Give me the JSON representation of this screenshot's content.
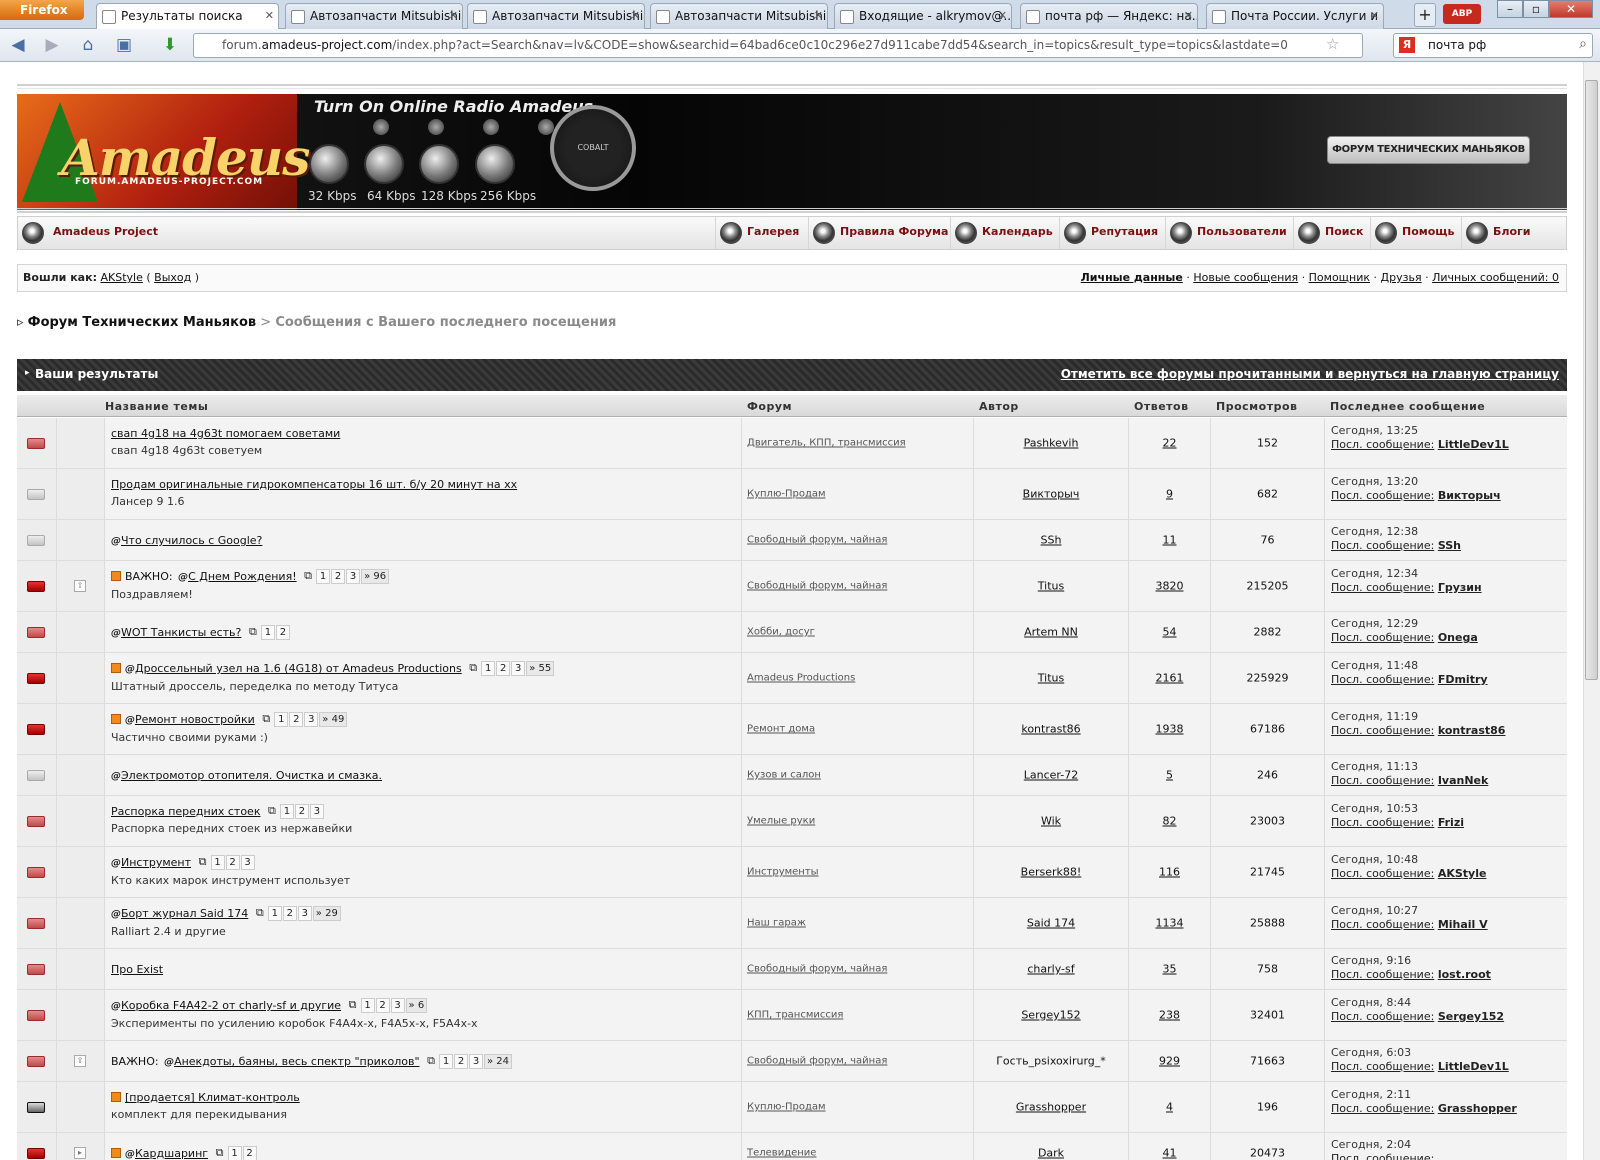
{
  "browser": {
    "menu_label": "Firefox",
    "tabs": [
      {
        "label": "Результаты поиска",
        "active": true
      },
      {
        "label": "Автозапчасти Mitsubishi ..."
      },
      {
        "label": "Автозапчасти Mitsubishi ..."
      },
      {
        "label": "Автозапчасти Mitsubishi ..."
      },
      {
        "label": "Входящие - alkrymov@..."
      },
      {
        "label": "почта рф — Яндекс: на..."
      },
      {
        "label": "Почта России. Услуги и ..."
      }
    ],
    "new_tab_label": "+",
    "addon_label": "ABP",
    "url_prefix": "forum.",
    "url_domain": "amadeus-project.com",
    "url_rest": "/index.php?act=Search&nav=lv&CODE=show&searchid=64bad6ce0c10c296e27d911cabe7dd54&search_in=topics&result_type=topics&lastdate=0",
    "search_engine_glyph": "Я",
    "search_value": "почта рф"
  },
  "banner": {
    "logo": "Amadeus",
    "logo_url": "FORUM.AMADEUS-PROJECT.COM",
    "radio_title": "Turn On Online Radio Amadeus",
    "kbps": [
      "32 Kbps",
      "64 Kbps",
      "128 Kbps",
      "256 Kbps"
    ],
    "gauge_label": "COBALT",
    "badge": "ФОРУМ ТЕХНИЧЕСКИХ МАНЬЯКОВ"
  },
  "nav": {
    "brand": "Amadeus Project",
    "items": [
      "Галерея",
      "Правила Форума",
      "Календарь",
      "Репутация",
      "Пользователи",
      "Поиск",
      "Помощь",
      "Блоги"
    ]
  },
  "user": {
    "logged_as": "Вошли как:",
    "name": "AKStyle",
    "logout": "Выход",
    "links": [
      "Личные данные",
      "Новые сообщения",
      "Помощник",
      "Друзья",
      "Личных сообщений: 0"
    ]
  },
  "breadcrumb": {
    "marker": "▹",
    "forum": "Форум Технических Маньяков",
    "separator": ">",
    "current": "Сообщения с Вашего последнего посещения"
  },
  "results": {
    "title": "Ваши результаты",
    "mark_read": "Отметить все форумы прочитанными и вернуться на главную страницу",
    "columns": [
      "Название темы",
      "Форум",
      "Автор",
      "Ответов",
      "Просмотров",
      "Последнее сообщение"
    ],
    "last_prefix": "Посл. сообщение:",
    "rows": [
      {
        "folder": "red",
        "hot": false,
        "important": false,
        "clip": false,
        "title": "свап 4g18 на 4g63t помогаем советами",
        "pages": [],
        "desc": "свап 4g18 4g63t советуем",
        "forum": "Двигатель, КПП, трансмиссия",
        "author": "Pashkevih",
        "replies": "22",
        "views": "152",
        "last_time": "Сегодня, 13:25",
        "last_user": "LittleDev1L"
      },
      {
        "folder": "grey",
        "hot": false,
        "important": false,
        "clip": false,
        "title": "Продам оригинальные гидрокомпенсаторы 16 шт. б/у 20 минут на хх",
        "pages": [],
        "desc": "Лансер 9 1.6",
        "forum": "Куплю-Продам",
        "author": "Викторыч",
        "replies": "9",
        "views": "682",
        "last_time": "Сегодня, 13:20",
        "last_user": "Викторыч"
      },
      {
        "folder": "grey",
        "hot": false,
        "important": false,
        "clip": true,
        "title": "Что случилось с Google?",
        "pages": [],
        "desc": "",
        "forum": "Свободный форум, чайная",
        "author": "SSh",
        "replies": "11",
        "views": "76",
        "last_time": "Сегодня, 12:38",
        "last_user": "SSh"
      },
      {
        "folder": "hot",
        "pin": "⇧",
        "hot": true,
        "important": true,
        "clip": true,
        "title": "С Днем Рождения!",
        "pages": [
          "1",
          "2",
          "3",
          "» 96"
        ],
        "desc": "Поздравляем!",
        "forum": "Свободный форум, чайная",
        "author": "Titus",
        "replies": "3820",
        "views": "215205",
        "last_time": "Сегодня, 12:34",
        "last_user": "Грузин"
      },
      {
        "folder": "red",
        "hot": false,
        "important": false,
        "clip": true,
        "title": "WOT Танкисты есть?",
        "pages": [
          "1",
          "2"
        ],
        "desc": "",
        "forum": "Хобби, досуг",
        "author": "Artem NN",
        "replies": "54",
        "views": "2882",
        "last_time": "Сегодня, 12:29",
        "last_user": "Onega"
      },
      {
        "folder": "hot",
        "hot": true,
        "important": false,
        "clip": true,
        "title": "Дроссельный узел на 1.6 (4G18) от Amadeus Productions",
        "pages": [
          "1",
          "2",
          "3",
          "» 55"
        ],
        "desc": "Штатный дроссель, переделка по методу Титуса",
        "forum": "Amadeus Productions",
        "author": "Titus",
        "replies": "2161",
        "views": "225929",
        "last_time": "Сегодня, 11:48",
        "last_user": "FDmitry"
      },
      {
        "folder": "hot",
        "hot": true,
        "important": false,
        "clip": true,
        "title": "Ремонт новостройки",
        "pages": [
          "1",
          "2",
          "3",
          "» 49"
        ],
        "desc": "Частично своими руками :)",
        "forum": "Ремонт дома",
        "author": "kontrast86",
        "replies": "1938",
        "views": "67186",
        "last_time": "Сегодня, 11:19",
        "last_user": "kontrast86"
      },
      {
        "folder": "grey",
        "hot": false,
        "important": false,
        "clip": true,
        "title": "Электромотор отопителя. Очистка и смазка.",
        "pages": [],
        "desc": "",
        "forum": "Кузов и салон",
        "author": "Lancer-72",
        "replies": "5",
        "views": "246",
        "last_time": "Сегодня, 11:13",
        "last_user": "IvanNek"
      },
      {
        "folder": "red",
        "hot": false,
        "important": false,
        "clip": false,
        "title": "Распорка передних стоек",
        "pages": [
          "1",
          "2",
          "3"
        ],
        "desc": "Распорка передних стоек из нержавейки",
        "forum": "Умелые руки",
        "author": "Wik",
        "replies": "82",
        "views": "23003",
        "last_time": "Сегодня, 10:53",
        "last_user": "Frizi"
      },
      {
        "folder": "red",
        "hot": false,
        "important": false,
        "clip": true,
        "title": "Инструмент",
        "pages": [
          "1",
          "2",
          "3"
        ],
        "desc": "Кто каких марок инструмент использует",
        "forum": "Инструменты",
        "author": "Berserk88!",
        "replies": "116",
        "views": "21745",
        "last_time": "Сегодня, 10:48",
        "last_user": "AKStyle"
      },
      {
        "folder": "red",
        "hot": false,
        "important": false,
        "clip": true,
        "title": "Борт журнал Said 174",
        "pages": [
          "1",
          "2",
          "3",
          "» 29"
        ],
        "desc": "Ralliart 2.4 и другие",
        "forum": "Наш гараж",
        "author": "Said 174",
        "replies": "1134",
        "views": "25888",
        "last_time": "Сегодня, 10:27",
        "last_user": "Mihail V"
      },
      {
        "folder": "red",
        "hot": false,
        "important": false,
        "clip": false,
        "title": "Про Exist",
        "pages": [],
        "desc": "",
        "forum": "Свободный форум, чайная",
        "author": "charly-sf",
        "replies": "35",
        "views": "758",
        "last_time": "Сегодня, 9:16",
        "last_user": "lost.root"
      },
      {
        "folder": "red",
        "hot": false,
        "important": false,
        "clip": true,
        "title": "Коробка F4A42-2 от charly-sf и другие",
        "pages": [
          "1",
          "2",
          "3",
          "» 6"
        ],
        "desc": "Эксперименты по усилению коробок F4A4x-x, F4A5x-x, F5A4x-x",
        "forum": "КПП, трансмиссия",
        "author": "Sergey152",
        "replies": "238",
        "views": "32401",
        "last_time": "Сегодня, 8:44",
        "last_user": "Sergey152"
      },
      {
        "folder": "red",
        "pin": "⇧",
        "hot": false,
        "important": true,
        "clip": true,
        "title": "Анекдоты, баяны, весь спектр \"приколов\"",
        "pages": [
          "1",
          "2",
          "3",
          "» 24"
        ],
        "desc": "",
        "forum": "Свободный форум, чайная",
        "author": "Гость_psixoxirurg_*",
        "guest": true,
        "replies": "929",
        "views": "71663",
        "last_time": "Сегодня, 6:03",
        "last_user": "LittleDev1L"
      },
      {
        "folder": "black",
        "hot": true,
        "important": false,
        "clip": false,
        "title": "[продается] Климат-контроль",
        "pages": [],
        "desc": "комплект для перекидывания",
        "forum": "Куплю-Продам",
        "author": "Grasshopper",
        "replies": "4",
        "views": "196",
        "last_time": "Сегодня, 2:11",
        "last_user": "Grasshopper"
      },
      {
        "folder": "hot",
        "pin": "▸",
        "hot": true,
        "important": false,
        "clip": true,
        "title": "Кардшаринг",
        "pages": [
          "1",
          "2"
        ],
        "desc": "",
        "forum": "Телевидение",
        "author": "Dark",
        "replies": "41",
        "views": "20473",
        "last_time": "Сегодня, 2:04",
        "last_user": ""
      }
    ],
    "important_prefix": "ВАЖНО:",
    "clip_glyph": "@"
  },
  "colors": {
    "accent": "#7a1010",
    "bar": "#2f2f2f",
    "hot_folder": "#c00000"
  }
}
